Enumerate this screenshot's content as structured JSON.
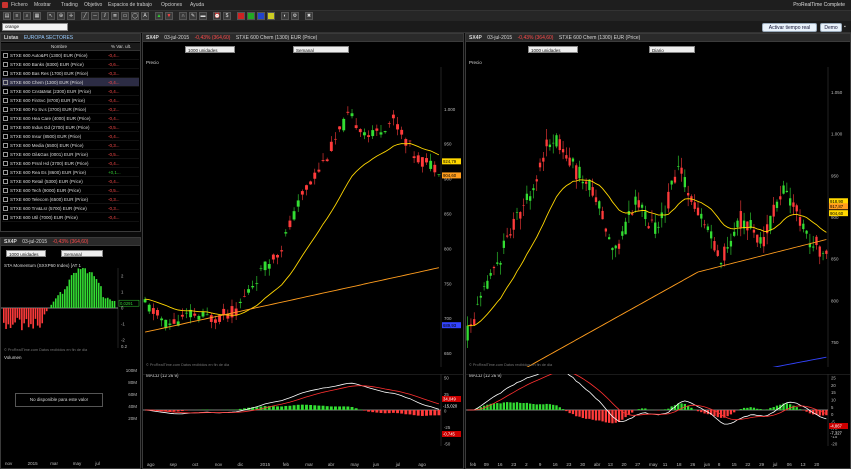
{
  "menu": [
    "Fichero",
    "Mostrar",
    "Trading",
    "Objetivo",
    "Espacios de trabajo",
    "Opciones",
    "Ayuda"
  ],
  "brand": "ProRealTime Complete",
  "search": {
    "value": "orange"
  },
  "buttons": {
    "live": "Activar tiempo real",
    "demo": "Demo"
  },
  "list": {
    "title": "Listas",
    "list_name": "EUROPA SECTORES",
    "col_name": "Nombre",
    "col_change": "% Var. ult.",
    "items": [
      {
        "name": "STXE 600 Auto&Pt (1300) EUR (Price)",
        "chg": "-0,4..."
      },
      {
        "name": "STXE 600 Banks (8300) EUR (Price)",
        "chg": "-0,6..."
      },
      {
        "name": "STXE 600 Bas Res (1700) EUR (Price)",
        "chg": "-0,3..."
      },
      {
        "name": "STXE 600 Chem (1300) EUR (Price)",
        "chg": "-0,4..."
      },
      {
        "name": "STXE 600 Cnst&Mat (2300) EUR (Price)",
        "chg": "-0,4..."
      },
      {
        "name": "STXE 600 FinSvc (8700) EUR (Price)",
        "chg": "-0,4..."
      },
      {
        "name": "STXE 600 Fo Sv.s (3700) EUR (Price)",
        "chg": "-0,2..."
      },
      {
        "name": "STXE 600 Hea Care (4000) EUR (Price)",
        "chg": "-0,4..."
      },
      {
        "name": "STXE 600 Indus Gd (2700) EUR (Price)",
        "chg": "-0,5..."
      },
      {
        "name": "STXE 600 Insur (8500) EUR (Price)",
        "chg": "-0,4..."
      },
      {
        "name": "STXE 600 Media (5500) EUR (Price)",
        "chg": "-0,3..."
      },
      {
        "name": "STXE 600 Oil&Gas (0001) EUR (Price)",
        "chg": "-0,5..."
      },
      {
        "name": "STXE 600 Prsnl Hd (3700) EUR (Price)",
        "chg": "-0,4..."
      },
      {
        "name": "STXE 600 Rea Es (8600) EUR (Price)",
        "chg": "+0,1..."
      },
      {
        "name": "STXE 600 Retail (5300) EUR (Price)",
        "chg": "-0,4..."
      },
      {
        "name": "STXE 600 Tech (9000) EUR (Price)",
        "chg": "-0,5..."
      },
      {
        "name": "STXE 600 Telecom (6500) EUR (Price)",
        "chg": "-0,3..."
      },
      {
        "name": "STXE 600 Trv&Lsr (5700) EUR (Price)",
        "chg": "-0,3..."
      },
      {
        "name": "STXE 600 Util (7000) EUR (Price)",
        "chg": "-0,4..."
      }
    ]
  },
  "small_chart": {
    "title": "SX4P",
    "date": "03-jul-2015",
    "change": "-0,43% (364,60)",
    "sel1": "1000 unidades",
    "sel2": "Semanal",
    "indicator": "STA Momentum (SXXP60 Index) [AT 1",
    "last": "0,0291",
    "ticks": [
      "2",
      "1",
      "0",
      "-1",
      "-2",
      "0,2"
    ],
    "volume_title": "Volumen",
    "vol_ticks": [
      "100M",
      "80M",
      "60M",
      "40M",
      "20M"
    ],
    "unavailable": "No disponible para este valor",
    "watermark": "© ProRealTime.com  Datos recibidos en fin de dia",
    "xlabels": [
      "nov",
      "2015",
      "mar",
      "may",
      "jul"
    ]
  },
  "chart_mid": {
    "title": "SX4P",
    "date": "03-jul-2015",
    "change": "-0,43% (364,60)",
    "name": "STXE 600 Chem (1300) EUR (Price)",
    "sel1": "1000 unidades",
    "sel2": "Semanal",
    "price_label": "Precio",
    "ticks": [
      "1.000",
      "950",
      "900",
      "850",
      "800",
      "750",
      "700",
      "650"
    ],
    "labels": {
      "p1": "924,79",
      "p2": "904,60",
      "p3": "770,12",
      "p4": "689,93"
    },
    "macd_title": "MACD (12 26 9)",
    "macd_ticks": [
      "50",
      "25",
      "0",
      "-25",
      "-50"
    ],
    "macd_labels": {
      "a": "34,049",
      "b": "-15,020",
      "c": "-0,745"
    },
    "watermark": "© ProRealTime.com  Datos recibidos en fin de dia",
    "xlabels": [
      "ago",
      "sep",
      "oct",
      "nov",
      "dic",
      "2015",
      "feb",
      "mar",
      "abr",
      "may",
      "jun",
      "jul",
      "ago"
    ]
  },
  "chart_right": {
    "title": "SX4P",
    "date": "03-jul-2015",
    "change": "-0,43% (364,60)",
    "name": "STXE 600 Chem (1300) EUR (Price)",
    "sel1": "1000 unidades",
    "sel2": "Diario",
    "price_label": "Precio",
    "ticks": [
      "1.050",
      "1.000",
      "950",
      "900",
      "850",
      "800",
      "750"
    ],
    "labels": {
      "p1": "918,90",
      "p2": "917,87",
      "p3": "904,60"
    },
    "macd_title": "MACD (12 26 9)",
    "macd_ticks": [
      "25",
      "20",
      "15",
      "10",
      "5",
      "0",
      "-5",
      "-10",
      "-15",
      "-20"
    ],
    "macd_labels": {
      "a": "-4,867",
      "b": "-7,327"
    },
    "watermark": "© ProRealTime.com  Datos recibidos en fin de dia",
    "xlabels": [
      "feb",
      "09",
      "16",
      "23",
      "2",
      "9",
      "16",
      "23",
      "30",
      "abr",
      "13",
      "20",
      "27",
      "may",
      "11",
      "18",
      "26",
      "jun",
      "8",
      "15",
      "22",
      "29",
      "jul",
      "06",
      "13",
      "20"
    ]
  },
  "colors": {
    "up": "#33dd33",
    "down": "#ff3b3b",
    "ma_fast": "#ffd700",
    "ma_mid": "#ff9d1e",
    "ma_slow": "#3344ff",
    "label_yellow": "#ffd700",
    "label_orange": "#ff9d1e",
    "label_blue": "#3344ff"
  }
}
